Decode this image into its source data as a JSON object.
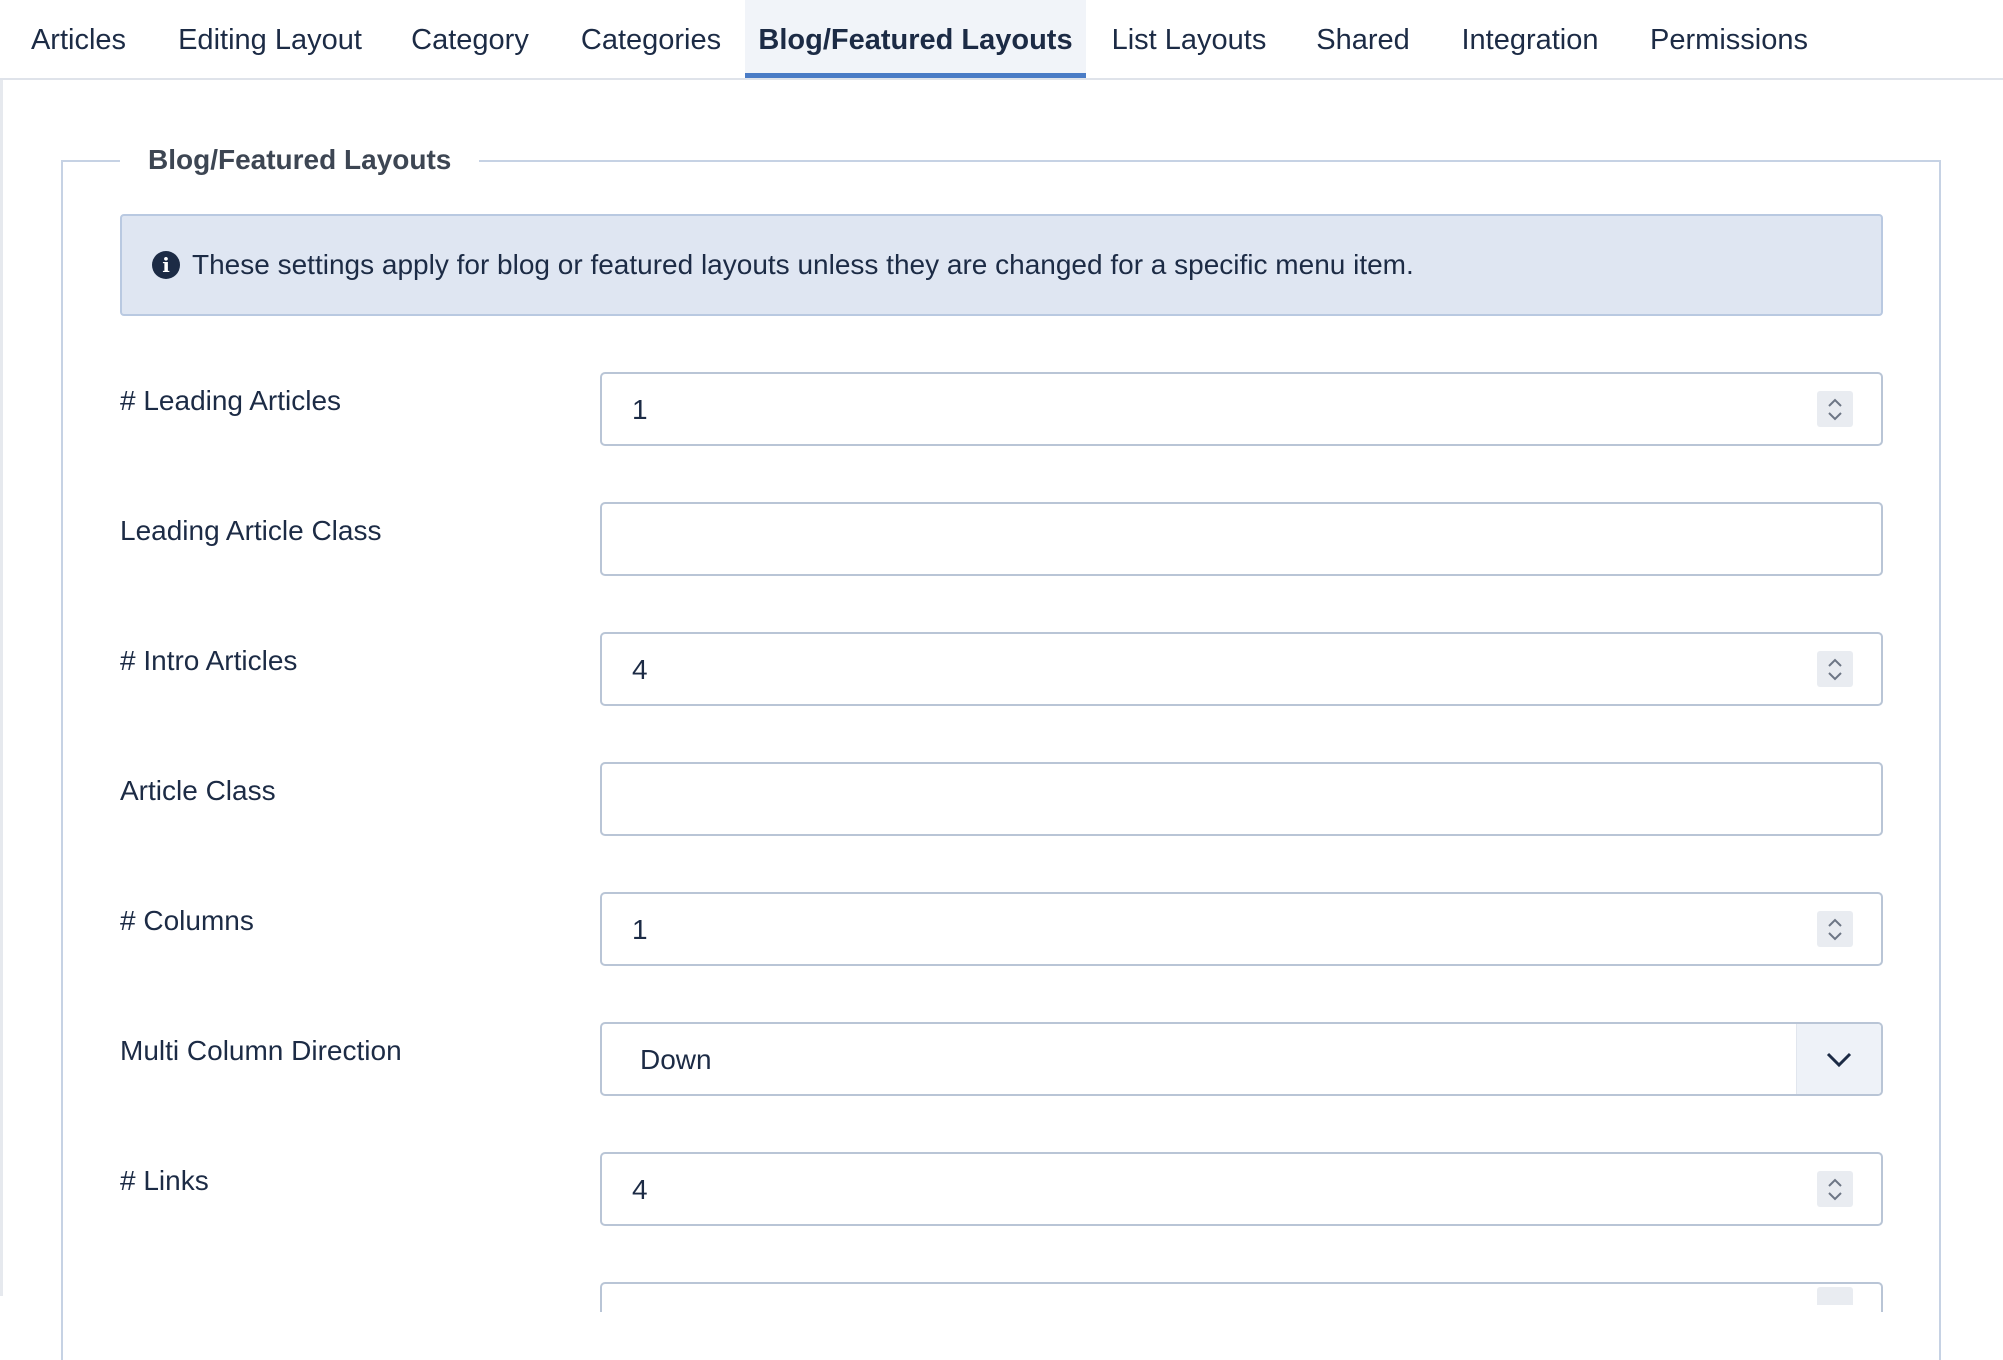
{
  "tabs": [
    {
      "label": "Articles"
    },
    {
      "label": "Editing Layout"
    },
    {
      "label": "Category"
    },
    {
      "label": "Categories"
    },
    {
      "label": "Blog/Featured Layouts",
      "active": true
    },
    {
      "label": "List Layouts"
    },
    {
      "label": "Shared"
    },
    {
      "label": "Integration"
    },
    {
      "label": "Permissions"
    }
  ],
  "fieldset": {
    "legend": "Blog/Featured Layouts",
    "alert_text": "These settings apply for blog or featured layouts unless they are changed for a specific menu item."
  },
  "fields": {
    "leading_articles": {
      "label": "# Leading Articles",
      "value": "1"
    },
    "leading_article_class": {
      "label": "Leading Article Class",
      "value": ""
    },
    "intro_articles": {
      "label": "# Intro Articles",
      "value": "4"
    },
    "article_class": {
      "label": "Article Class",
      "value": ""
    },
    "columns": {
      "label": "# Columns",
      "value": "1"
    },
    "multi_column_direction": {
      "label": "Multi Column Direction",
      "value": "Down"
    },
    "links": {
      "label": "# Links",
      "value": "4"
    }
  },
  "colors": {
    "accent": "#4a7cc6",
    "text": "#1c2b45",
    "alert_bg": "#dfe6f2",
    "border": "#b9c5d6"
  }
}
